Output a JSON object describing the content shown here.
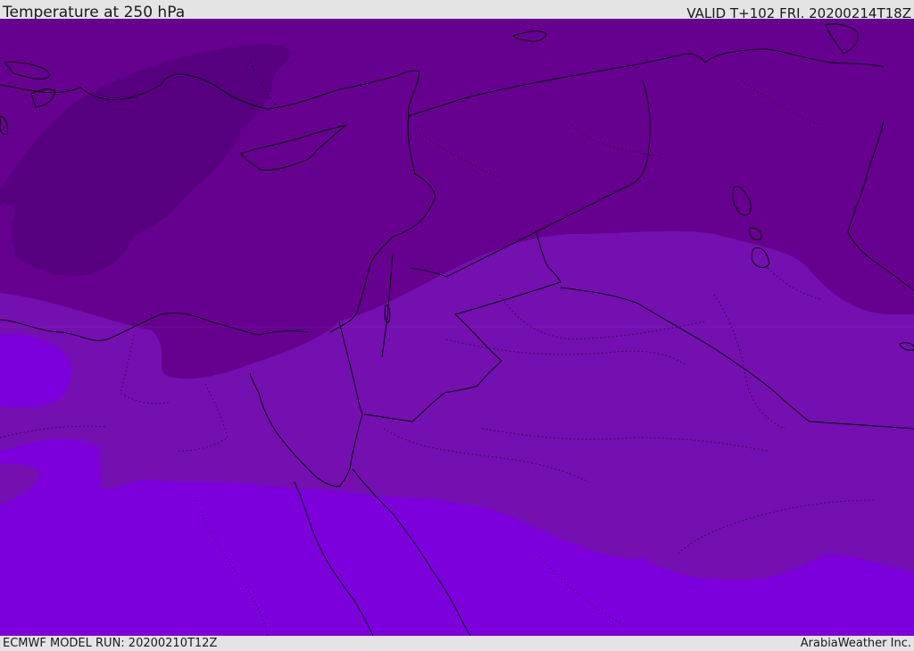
{
  "header": {
    "title": "Temperature at 250 hPa",
    "valid_time": "VALID T+102 FRI. 20200214T18Z"
  },
  "footer": {
    "model_run": "ECMWF MODEL RUN: 20200210T12Z",
    "credit": "ArabiaWeather Inc."
  },
  "map": {
    "region": "Eastern Mediterranean and Middle East",
    "field": "250 hPa temperature shading",
    "colors": {
      "coldest_band": "#56007f",
      "cold_band": "#66008f",
      "mid_band": "#7410b0",
      "warm_band": "#7c00dc",
      "coastline": "#000000"
    },
    "layers": [
      "temperature-shading",
      "coastlines",
      "country-borders",
      "province-borders"
    ]
  }
}
